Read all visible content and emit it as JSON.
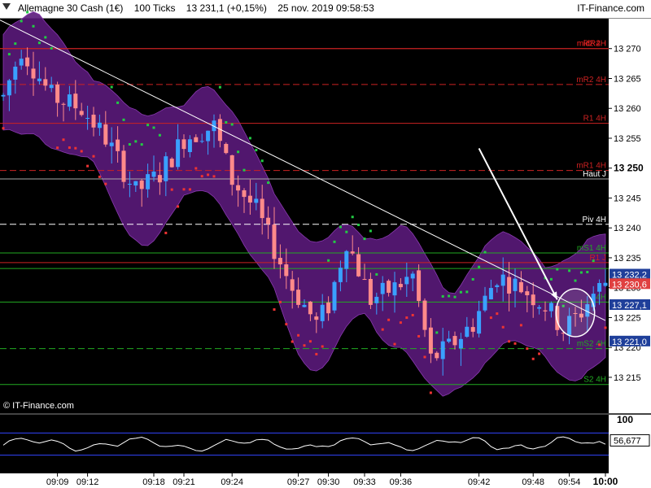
{
  "header": {
    "instrument": "Allemagne 30 Cash (1€)",
    "ticks": "100 Ticks",
    "last_price": "13 231,1 (+0,15%)",
    "datetime": "25 nov. 2019 09:58:53",
    "brand": "IT-Finance.com"
  },
  "copyright": "© IT-Finance.com",
  "chart_data": {
    "type": "candlestick",
    "y_axis": {
      "range": [
        13209,
        13275
      ],
      "ticks": [
        13270,
        13265,
        13260,
        13255,
        13250,
        13245,
        13240,
        13235,
        13230,
        13225,
        13220,
        13215
      ],
      "tick_labels": [
        "13 270",
        "13 265",
        "13 260",
        "13 255",
        "13 250",
        "13 245",
        "13 240",
        "13 235",
        "13 230",
        "13 225",
        "13 220",
        "13 215"
      ],
      "bold_tick": 13250
    },
    "x_axis": {
      "labels": [
        {
          "text": "09:09",
          "i": 9
        },
        {
          "text": "09:12",
          "i": 14
        },
        {
          "text": "09:18",
          "i": 25
        },
        {
          "text": "09:21",
          "i": 30
        },
        {
          "text": "09:24",
          "i": 38
        },
        {
          "text": "09:27",
          "i": 49
        },
        {
          "text": "09:30",
          "i": 54
        },
        {
          "text": "09:33",
          "i": 60
        },
        {
          "text": "09:36",
          "i": 66
        },
        {
          "text": "09:42",
          "i": 79
        },
        {
          "text": "09:48",
          "i": 88
        },
        {
          "text": "09:54",
          "i": 94
        },
        {
          "text": "10:00",
          "i": 100
        }
      ]
    },
    "candles_count": 101,
    "levels": [
      {
        "label": "midR2H",
        "value": 13270,
        "color": "#cc2222",
        "style": "solid",
        "label_color": "#ff2020"
      },
      {
        "label": "R2 4H",
        "value": 13270,
        "color": "#cc2222",
        "style": "solid"
      },
      {
        "label": "mR2 4H",
        "value": 13264,
        "color": "#cc2222",
        "style": "dashed"
      },
      {
        "label": "R1 4H",
        "value": 13257.5,
        "color": "#cc2222",
        "style": "solid"
      },
      {
        "label": "mR1 4H",
        "value": 13249.6,
        "color": "#cc2222",
        "style": "dashed"
      },
      {
        "label": "Haut J",
        "value": 13248.2,
        "color": "#aaaaaa",
        "style": "solid",
        "label_color": "#ffffff"
      },
      {
        "label": "Piv 4H",
        "value": 13240.6,
        "color": "#ffffff",
        "style": "dashed",
        "label_color": "#ffffff"
      },
      {
        "label": "R1 J",
        "value": 13234.2,
        "color": "#cc2222",
        "style": "solid"
      },
      {
        "label": "mS1 4H",
        "value": 13235.8,
        "color": "#22aa22",
        "style": "solid"
      },
      {
        "label": "4H",
        "value": 13227.6,
        "color": "#22aa22",
        "style": "solid"
      },
      {
        "label": "mS2 4H",
        "value": 13219.8,
        "color": "#22aa22",
        "style": "dashed"
      },
      {
        "label": "S2 4H",
        "value": 13213.8,
        "color": "#22aa22",
        "style": "solid"
      }
    ],
    "price_tags": [
      {
        "text": "13 232,2",
        "value": 13232.2,
        "bg": "#1f3f9a",
        "fg": "#ffffff"
      },
      {
        "text": "13 230,6",
        "value": 13230.6,
        "bg": "#e04040",
        "fg": "#ffffff"
      },
      {
        "text": "13 227,1",
        "value": 13227.1,
        "bg": "#1f3f9a",
        "fg": "#ffffff"
      },
      {
        "text": "13 221,0",
        "value": 13221.0,
        "bg": "#1f3f9a",
        "fg": "#ffffff"
      }
    ],
    "annotations": [
      {
        "kind": "trendline",
        "from": {
          "i": -1,
          "v": 13275
        },
        "to": {
          "i": 100,
          "v": 13224.5
        }
      },
      {
        "kind": "arrow",
        "from": {
          "i": 79,
          "v": 13253.3
        },
        "to": {
          "i": 92,
          "v": 13228
        }
      },
      {
        "kind": "ellipse",
        "center": {
          "i": 95,
          "v": 13225.8
        },
        "ri": 3.2,
        "rv": 4
      }
    ],
    "oscillator": {
      "top_label": "100",
      "value_label": "56,677",
      "range": [
        0,
        100
      ],
      "upper_line": 70,
      "lower_line": 30
    }
  }
}
